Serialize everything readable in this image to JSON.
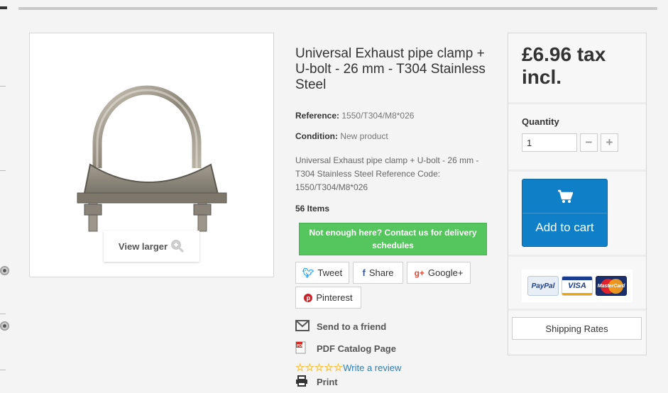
{
  "product": {
    "title": "Universal Exhaust pipe clamp + U-bolt - 26 mm - T304 Stainless Steel",
    "reference_label": "Reference:",
    "reference_value": "1550/T304/M8*026",
    "condition_label": "Condition:",
    "condition_value": "New product",
    "description": "Universal Exhaust pipe clamp + U-bolt - 26 mm - T304 Stainless Steel Reference Code: 1550/T304/M8*026",
    "items": "56 Items",
    "view_larger": "View larger"
  },
  "contact_button": "Not enough here? Contact us for delivery schedules",
  "social": {
    "tweet": "Tweet",
    "share": "Share",
    "google": "Google+",
    "pinterest": "Pinterest"
  },
  "actions": {
    "send_friend": "Send to a friend",
    "pdf": "PDF Catalog Page",
    "write_review": "Write a review",
    "print": "Print"
  },
  "rating": {
    "stars_filled": 0,
    "stars_total": 5
  },
  "buy": {
    "price": "£6.96 tax incl.",
    "quantity_label": "Quantity",
    "quantity_value": "1",
    "add_to_cart": "Add to cart",
    "payment_methods": [
      "PayPal",
      "VISA",
      "MasterCard"
    ],
    "shipping_rates": "Shipping Rates"
  },
  "colors": {
    "contact_green": "#55c65e",
    "cart_blue": "#0f7fc7",
    "twitter_blue": "#1da1f2",
    "facebook_blue": "#3b5998",
    "google_red": "#dd4b39",
    "pinterest_red": "#cb2027",
    "star_yellow": "#f6c342",
    "link_blue": "#2b7bb9"
  }
}
